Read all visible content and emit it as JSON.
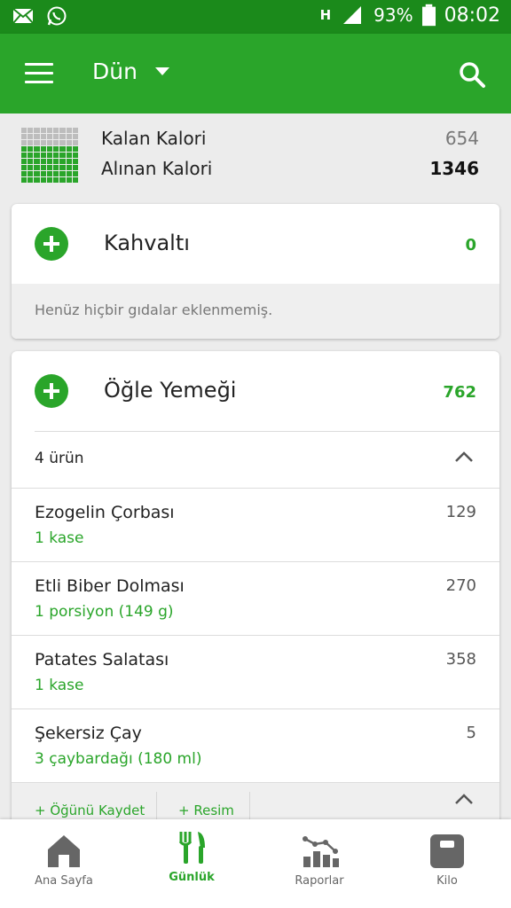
{
  "status_bar": {
    "battery": "93%",
    "time": "08:02",
    "network": "H",
    "icons": [
      "mail-icon",
      "whatsapp-icon",
      "signal-icon",
      "battery-icon"
    ]
  },
  "app_bar": {
    "title": "Dün",
    "icons": [
      "menu-icon",
      "dropdown-caret-icon",
      "search-icon"
    ]
  },
  "summary": {
    "remaining_label": "Kalan Kalori",
    "remaining_value": "654",
    "taken_label": "Alınan Kalori",
    "taken_value": "1346",
    "taken_fraction": 0.67
  },
  "breakfast": {
    "title": "Kahvaltı",
    "calories": "0",
    "empty_note": "Henüz hiçbir gıdalar eklenmemiş."
  },
  "lunch": {
    "title": "Öğle Yemeği",
    "calories": "762",
    "count_label": "4 ürün",
    "items": [
      {
        "name": "Ezogelin Çorbası",
        "portion": "1  kase",
        "kcal": "129"
      },
      {
        "name": "Etli Biber Dolması",
        "portion": "1  porsiyon (149 g)",
        "kcal": "270"
      },
      {
        "name": "Patates Salatası",
        "portion": "1  kase",
        "kcal": "358"
      },
      {
        "name": "Şekersiz Çay",
        "portion": "3  çaybardağı (180 ml)",
        "kcal": "5"
      }
    ],
    "save_meal": "+ Öğünü Kaydet",
    "add_photo": "+ Resim"
  },
  "bottom_nav": {
    "items": [
      {
        "label": "Ana Sayfa",
        "icon": "home-icon"
      },
      {
        "label": "Günlük",
        "icon": "fork-knife-icon"
      },
      {
        "label": "Raporlar",
        "icon": "chart-icon"
      },
      {
        "label": "Kilo",
        "icon": "scale-icon"
      }
    ],
    "active_index": 1
  },
  "colors": {
    "brand_green": "#2aa52a",
    "status_green": "#1b8a1b",
    "grid_remaining": "#bdbdbd"
  }
}
